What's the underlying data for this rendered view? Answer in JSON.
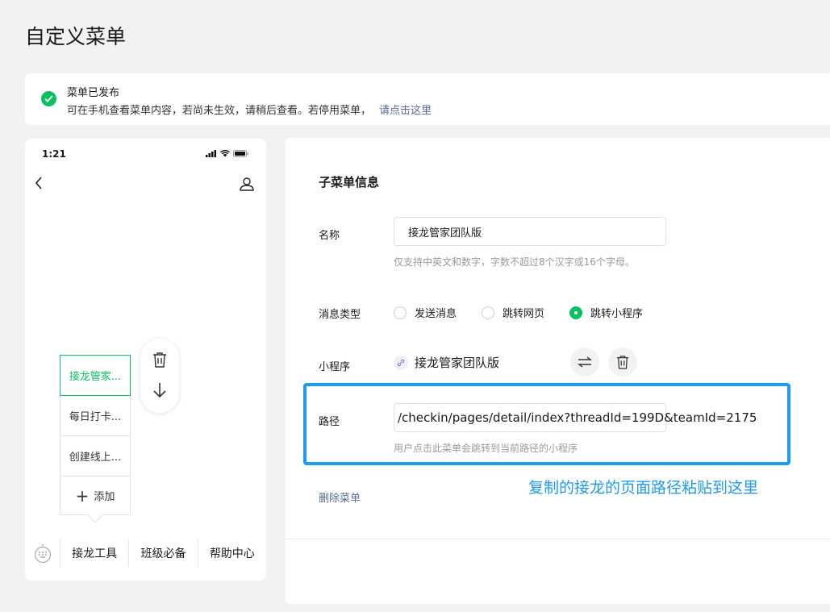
{
  "page": {
    "title": "自定义菜单"
  },
  "notice": {
    "title": "菜单已发布",
    "desc": "可在手机查看菜单内容，若尚未生效，请稍后查看。若停用菜单，",
    "link": "请点击这里",
    "accent_color": "#07c160",
    "link_color": "#576b95"
  },
  "phone": {
    "time": "1:21",
    "submenu": [
      {
        "label": "接龙管家...",
        "active": true
      },
      {
        "label": "每日打卡..."
      },
      {
        "label": "创建线上..."
      }
    ],
    "add_label": "添加",
    "menu_tabs": [
      "接龙工具",
      "班级必备",
      "帮助中心"
    ]
  },
  "editor": {
    "section_title": "子菜单信息",
    "name_label": "名称",
    "name_value": "接龙管家团队版",
    "name_hint": "仅支持中英文和数字，字数不超过8个汉字或16个字母。",
    "type_label": "消息类型",
    "type_options": [
      "发送消息",
      "跳转网页",
      "跳转小程序"
    ],
    "type_selected": "跳转小程序",
    "miniapp_label": "小程序",
    "miniapp_name": "接龙管家团队版",
    "path_label": "路径",
    "path_value": "/checkin/pages/detail/index?threadId=199D&teamId=2175",
    "path_hint": "用户点击此菜单会跳转到当前路径的小程序",
    "delete_label": "删除菜单"
  },
  "annotation": {
    "text": "复制的接龙的页面路径粘贴到这里",
    "color": "#1e9bf0"
  }
}
